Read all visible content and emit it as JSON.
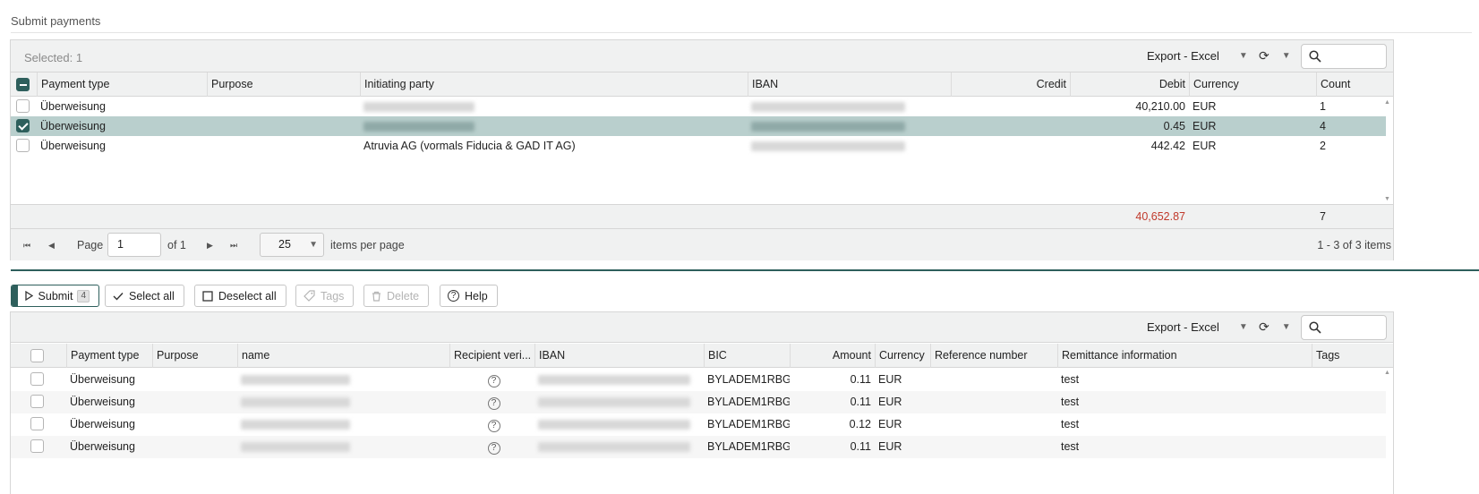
{
  "page": {
    "title": "Submit payments"
  },
  "top_grid": {
    "selected_text": "Selected: 1",
    "export_label": "Export - Excel",
    "search_placeholder": "",
    "columns": [
      "Payment type",
      "Purpose",
      "Initiating party",
      "IBAN",
      "Credit",
      "Debit",
      "Currency",
      "Count"
    ],
    "rows": [
      {
        "checked": false,
        "payment_type": "Überweisung",
        "purpose": "",
        "initiating_party": "",
        "iban": "",
        "credit": "",
        "debit": "40,210.00",
        "currency": "EUR",
        "count": "1"
      },
      {
        "checked": true,
        "payment_type": "Überweisung",
        "purpose": "",
        "initiating_party": "",
        "iban": "",
        "credit": "",
        "debit": "0.45",
        "currency": "EUR",
        "count": "4"
      },
      {
        "checked": false,
        "payment_type": "Überweisung",
        "purpose": "",
        "initiating_party": "Atruvia AG (vormals Fiducia & GAD IT AG)",
        "iban": "",
        "credit": "",
        "debit": "442.42",
        "currency": "EUR",
        "count": "2"
      }
    ],
    "totals": {
      "debit": "40,652.87",
      "count": "7",
      "debit_color": "#c0392b"
    },
    "pager": {
      "page_label": "Page",
      "page_value": "1",
      "of_label": "of 1",
      "page_size": "25",
      "items_per_page_label": "items per page",
      "range_text": "1 - 3 of 3 items"
    }
  },
  "actions": {
    "submit": {
      "label": "Submit",
      "badge": "4"
    },
    "select_all": "Select all",
    "deselect_all": "Deselect all",
    "tags": "Tags",
    "delete": "Delete",
    "help": "Help"
  },
  "bottom_grid": {
    "export_label": "Export - Excel",
    "search_placeholder": "",
    "columns": [
      "Payment type",
      "Purpose",
      "name",
      "Recipient veri...",
      "IBAN",
      "BIC",
      "Amount",
      "Currency",
      "Reference number",
      "Remittance information",
      "Tags"
    ],
    "rows": [
      {
        "payment_type": "Überweisung",
        "purpose": "",
        "name": "",
        "bic": "BYLADEM1RBG",
        "amount": "0.11",
        "currency": "EUR",
        "reference": "",
        "remittance": "test",
        "tags": ""
      },
      {
        "payment_type": "Überweisung",
        "purpose": "",
        "name": "",
        "bic": "BYLADEM1RBG",
        "amount": "0.11",
        "currency": "EUR",
        "reference": "",
        "remittance": "test",
        "tags": ""
      },
      {
        "payment_type": "Überweisung",
        "purpose": "",
        "name": "",
        "bic": "BYLADEM1RBG",
        "amount": "0.12",
        "currency": "EUR",
        "reference": "",
        "remittance": "test",
        "tags": ""
      },
      {
        "payment_type": "Überweisung",
        "purpose": "",
        "name": "",
        "bic": "BYLADEM1RBG",
        "amount": "0.11",
        "currency": "EUR",
        "reference": "",
        "remittance": "test",
        "tags": ""
      }
    ]
  },
  "colors": {
    "accent": "#2e5f5c",
    "selected_row": "#b9cfcd",
    "header_bg": "#f0f1f1"
  }
}
